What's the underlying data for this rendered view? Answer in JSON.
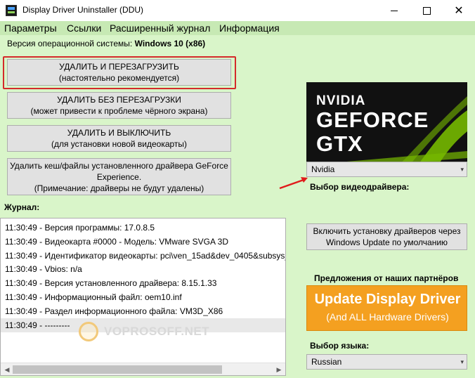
{
  "window": {
    "title": "Display Driver Uninstaller (DDU)",
    "minimize": "minimize",
    "maximize": "maximize",
    "close": "✕"
  },
  "menu": [
    "Параметры",
    "Ссылки",
    "Расширенный журнал",
    "Информация"
  ],
  "os": {
    "label": "Версия операционной системы:",
    "value": "Windows 10 (x86)"
  },
  "actions": [
    {
      "line1": "УДАЛИТЬ И ПЕРЕЗАГРУЗИТЬ",
      "line2": "(настоятельно рекомендуется)"
    },
    {
      "line1": "УДАЛИТЬ БЕЗ ПЕРЕЗАГРУЗКИ",
      "line2": "(может привести к проблеме чёрного экрана)"
    },
    {
      "line1": "УДАЛИТЬ И ВЫКЛЮЧИТЬ",
      "line2": "(для установки новой видеокарты)"
    },
    {
      "line1": "Удалить кеш/файлы установленного драйвера GeForce",
      "line2": "Experience.",
      "line3": "(Примечание: драйверы не будут удалены)"
    }
  ],
  "journal": {
    "label": "Журнал:",
    "lines": [
      "11:30:49 - Версия программы: 17.0.8.5",
      "11:30:49 - Видеокарта #0000 - Модель: VMware SVGA 3D",
      "11:30:49 - Идентификатор видеокарты: pci\\ven_15ad&dev_0405&subsys_",
      "11:30:49 - Vbios: n/a",
      "11:30:49 - Версия установленного драйвера: 8.15.1.33",
      "11:30:49 - Информационный файл: oem10.inf",
      "11:30:49 - Раздел информационного файла: VM3D_X86",
      "11:30:49 - ---------"
    ]
  },
  "watermark": "VOPROSOFF.NET",
  "logo": {
    "brand": "NVIDIA",
    "line2": "GEFORCE",
    "line3": "GTX"
  },
  "driver_select": {
    "value": "Nvidia",
    "label": "Выбор видеодрайвера:"
  },
  "windows_update": {
    "line1": "Включить установку драйверов через",
    "line2": "Windows Update по умолчанию"
  },
  "partners": {
    "label": "Предложения от наших партнёров",
    "banner_line1": "Update Display Driver",
    "banner_line2": "(And ALL Hardware Drivers)"
  },
  "language": {
    "label": "Выбор языка:",
    "value": "Russian"
  },
  "colors": {
    "client_bg": "#d9f5c9",
    "menubar_bg": "#c7e9b4",
    "highlight": "#d42a2a",
    "banner": "#f4a020",
    "nvidia_green": "#76b900"
  }
}
